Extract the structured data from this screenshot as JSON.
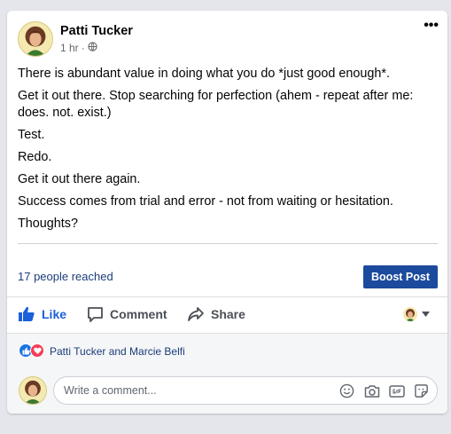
{
  "post": {
    "author": "Patti Tucker",
    "time": "1 hr",
    "time_separator": "·",
    "privacy_icon": "globe-icon",
    "menu_icon": "more-options-icon",
    "menu_glyph": "•••",
    "paragraphs": [
      "There is abundant value in doing what you do *just good enough*.",
      "Get it out there. Stop searching for perfection (ahem - repeat after me: does. not. exist.)",
      "Test.",
      "Redo.",
      "Get it out there again.",
      "Success comes from trial and error - not from waiting or hesitation.",
      "Thoughts?"
    ]
  },
  "insights": {
    "reach": "17 people reached",
    "boost_label": "Boost Post"
  },
  "actions": {
    "like": "Like",
    "comment": "Comment",
    "share": "Share"
  },
  "reactions": {
    "names": "Patti Tucker and Marcie Belfi",
    "icons": [
      "like-reaction-icon",
      "love-reaction-icon"
    ]
  },
  "comment_box": {
    "placeholder": "Write a comment...",
    "icons": [
      "emoji-icon",
      "camera-icon",
      "gif-icon",
      "sticker-icon"
    ]
  },
  "colors": {
    "brand_blue": "#1b5fd9",
    "boost_blue": "#1c4a9c",
    "love_red": "#f33e58"
  }
}
